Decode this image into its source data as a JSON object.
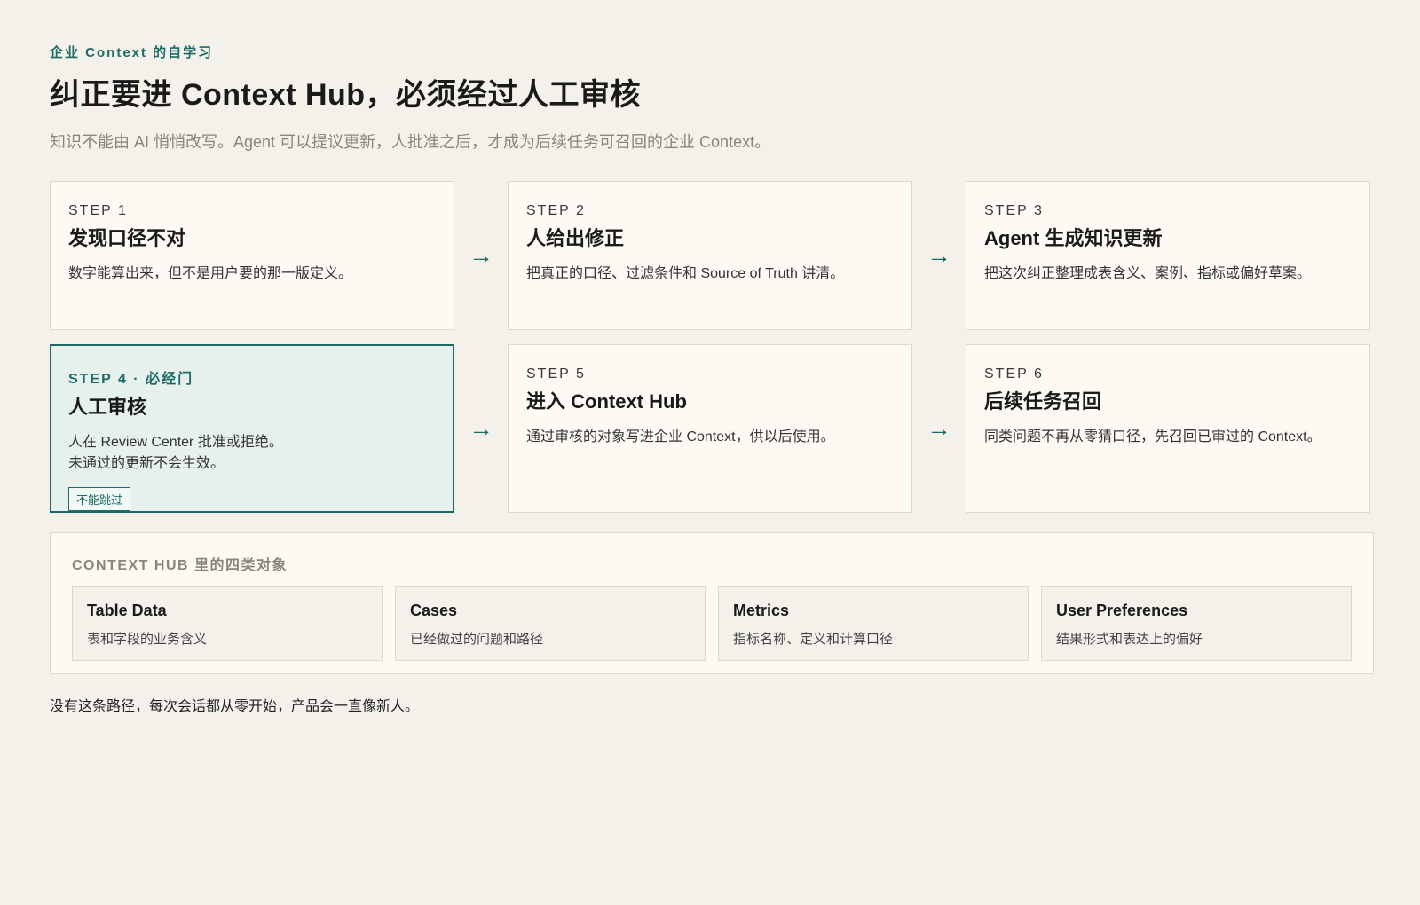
{
  "header": {
    "eyebrow": "企业 Context 的自学习",
    "title": "纠正要进 Context Hub，必须经过人工审核",
    "subtitle": "知识不能由 AI 悄悄改写。Agent 可以提议更新，人批准之后，才成为后续任务可召回的企业 Context。"
  },
  "steps": [
    {
      "label": "STEP 1",
      "title": "发现口径不对",
      "desc": "数字能算出来，但不是用户要的那一版定义。"
    },
    {
      "label": "STEP 2",
      "title": "人给出修正",
      "desc": "把真正的口径、过滤条件和 Source of Truth 讲清。"
    },
    {
      "label": "STEP 3",
      "title": "Agent 生成知识更新",
      "desc": "把这次纠正整理成表含义、案例、指标或偏好草案。"
    },
    {
      "label": "STEP 4 · 必经门",
      "title": "人工审核",
      "desc": "人在 Review Center 批准或拒绝。",
      "desc2": "未通过的更新不会生效。",
      "badge": "不能跳过"
    },
    {
      "label": "STEP 5",
      "title": "进入 Context Hub",
      "desc": "通过审核的对象写进企业 Context，供以后使用。"
    },
    {
      "label": "STEP 6",
      "title": "后续任务召回",
      "desc": "同类问题不再从零猜口径，先召回已审过的 Context。"
    }
  ],
  "arrow_glyph": "→",
  "hub": {
    "title": "CONTEXT HUB 里的四类对象",
    "objects": [
      {
        "name": "Table Data",
        "desc": "表和字段的业务含义"
      },
      {
        "name": "Cases",
        "desc": "已经做过的问题和路径"
      },
      {
        "name": "Metrics",
        "desc": "指标名称、定义和计算口径"
      },
      {
        "name": "User Preferences",
        "desc": "结果形式和表达上的偏好"
      }
    ]
  },
  "footer_note": "没有这条路径，每次会话都从零开始，产品会一直像新人。",
  "colors": {
    "accent": "#1d6b66",
    "background": "#f4f1ea",
    "card": "#fdfaf4",
    "gate_fill": "#e6f1ee"
  }
}
